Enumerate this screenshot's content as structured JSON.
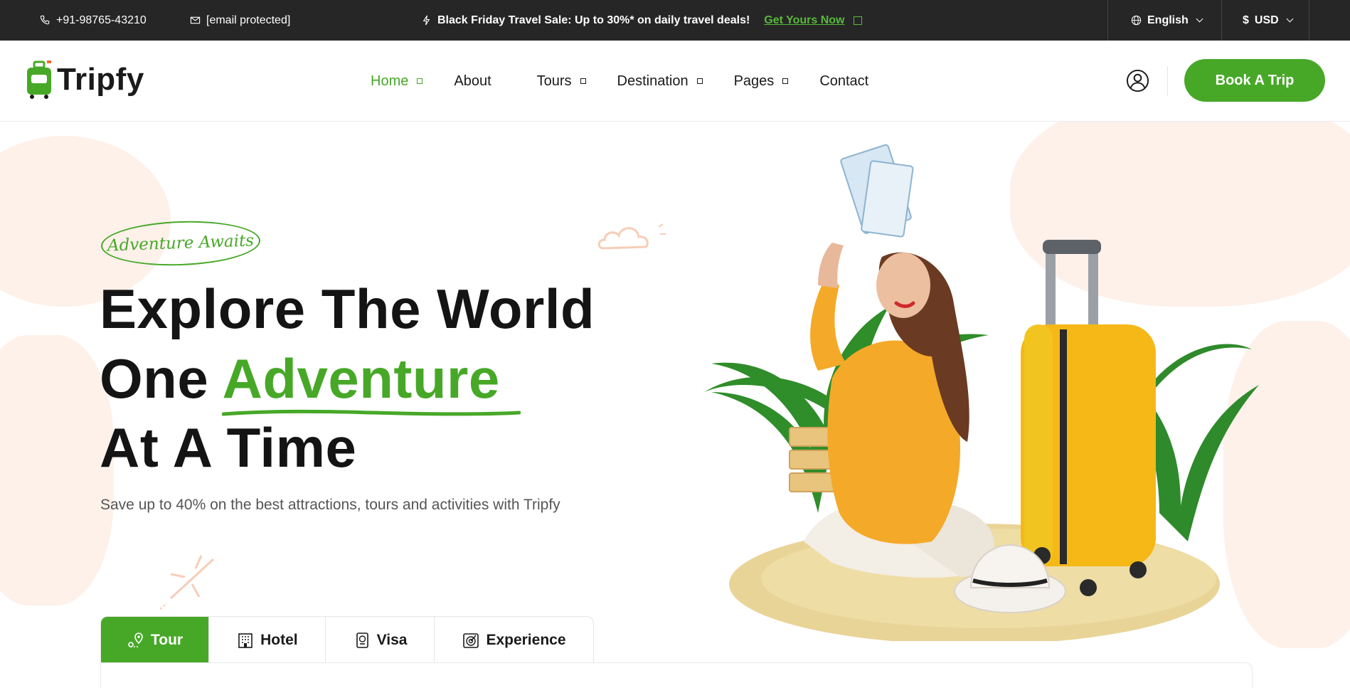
{
  "topbar": {
    "phone": "+91-98765-43210",
    "email": "[email protected]",
    "promo_text": "Black Friday Travel Sale: Up to 30%* on daily travel deals!",
    "promo_link": "Get Yours Now",
    "language": "English",
    "currency": "USD",
    "currency_symbol": "$"
  },
  "header": {
    "brand": "Tripfy",
    "nav": [
      {
        "label": "Home",
        "active": true,
        "has_dropdown": true
      },
      {
        "label": "About",
        "active": false,
        "has_dropdown": false
      },
      {
        "label": "Tours",
        "active": false,
        "has_dropdown": true
      },
      {
        "label": "Destination",
        "active": false,
        "has_dropdown": true
      },
      {
        "label": "Pages",
        "active": false,
        "has_dropdown": true
      },
      {
        "label": "Contact",
        "active": false,
        "has_dropdown": false
      }
    ],
    "cta": "Book A Trip"
  },
  "hero": {
    "badge": "Adventure Awaits",
    "line1": "Explore The World",
    "line2_prefix": "One",
    "line2_highlight": "Adventure",
    "line3": "At A Time",
    "subtext": "Save up to 40% on the best attractions, tours and activities with Tripfy"
  },
  "tabs": [
    {
      "label": "Tour",
      "icon": "map-pin-icon",
      "active": true
    },
    {
      "label": "Hotel",
      "icon": "hotel-icon",
      "active": false
    },
    {
      "label": "Visa",
      "icon": "passport-icon",
      "active": false
    },
    {
      "label": "Experience",
      "icon": "target-icon",
      "active": false
    }
  ],
  "colors": {
    "accent": "#47a828",
    "topbar_bg": "#262626",
    "heading": "#141414",
    "map_tint": "#fdf1ea"
  }
}
